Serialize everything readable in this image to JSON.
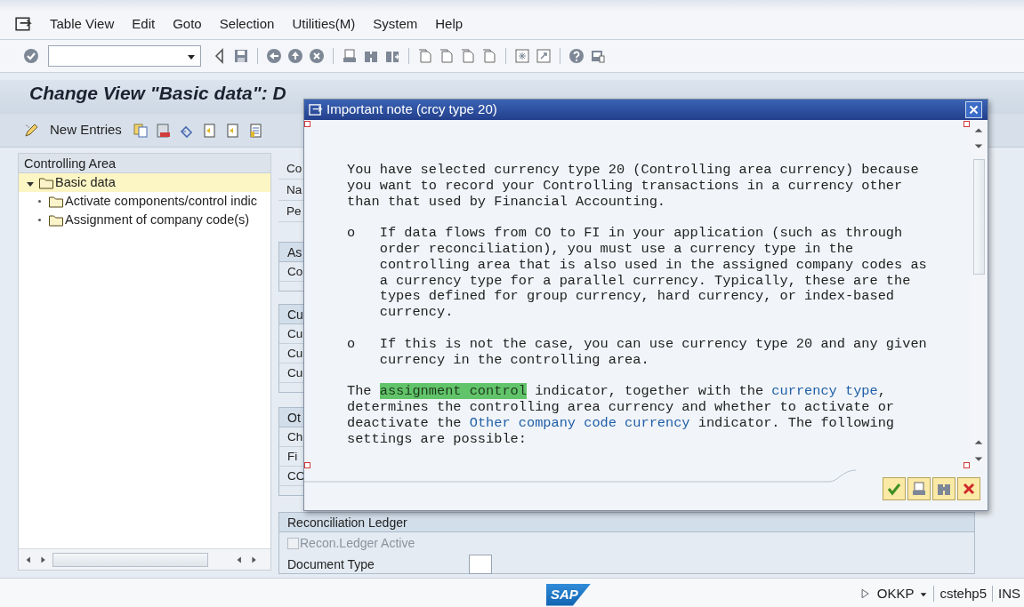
{
  "menu_bar": {
    "items": [
      "Table View",
      "Edit",
      "Goto",
      "Selection",
      "Utilities(M)",
      "System",
      "Help"
    ]
  },
  "title": "Change View \"Basic data\": D",
  "app_toolbar": {
    "new_entries": "New Entries"
  },
  "tree": {
    "header": "Controlling Area",
    "items": [
      {
        "label": "Basic data",
        "selected": true,
        "expanded": true,
        "children": [
          {
            "label": "Activate components/control indic",
            "selected": false
          },
          {
            "label": "Assignment of company code(s)",
            "selected": false
          }
        ]
      }
    ]
  },
  "header_fields": [
    "Co",
    "Na",
    "Pe"
  ],
  "groups": [
    {
      "title": "As",
      "fields": [
        "Co"
      ]
    },
    {
      "title": "Cu",
      "fields": [
        "Cu",
        "Cu",
        "Cu"
      ]
    },
    {
      "title": "Ot",
      "fields": [
        "Ch",
        "Fi",
        "CO"
      ]
    }
  ],
  "reconciliation": {
    "title": "Reconciliation Ledger",
    "checkbox": {
      "label": "Recon.Ledger Active",
      "checked": false,
      "disabled": true
    },
    "document_type": {
      "label": "Document Type"
    }
  },
  "dialog": {
    "title": "Important note (crcy type 20)",
    "paragraphs": [
      {
        "kind": "text",
        "segments": [
          {
            "kind": "text",
            "text": "You have selected currency type 20 (Controlling area currency) because you want to record your Controlling transactions in a currency other than that used by Financial Accounting."
          }
        ]
      },
      {
        "kind": "bullet",
        "marker": "o",
        "segments": [
          {
            "kind": "text",
            "text": "If data flows from CO to FI in your application (such as through order reconciliation), you must use a currency type in the controlling area that is also used in the assigned company codes as a currency type for a parallel currency. Typically, these are the types defined for group currency, hard currency, or index-based currency."
          }
        ]
      },
      {
        "kind": "bullet",
        "marker": "o",
        "segments": [
          {
            "kind": "text",
            "text": "If this is not the case, you can use currency type 20 and any given currency in the controlling area."
          }
        ]
      },
      {
        "kind": "text",
        "segments": [
          {
            "kind": "text",
            "text": "The "
          },
          {
            "kind": "link",
            "text": "assignment control",
            "selected": true
          },
          {
            "kind": "text",
            "text": " indicator, together with the "
          },
          {
            "kind": "link",
            "text": "currency type",
            "selected": false
          },
          {
            "kind": "text",
            "text": ", determines the controlling area currency and whether to activate or deactivate the "
          },
          {
            "kind": "link",
            "text": "Other company code currency",
            "selected": false
          },
          {
            "kind": "text",
            "text": " indicator. The following settings are possible:"
          }
        ]
      }
    ]
  },
  "status_bar": {
    "logo": "SAP",
    "transaction": "OKKP",
    "system": "cstehp5",
    "mode": "INS"
  }
}
